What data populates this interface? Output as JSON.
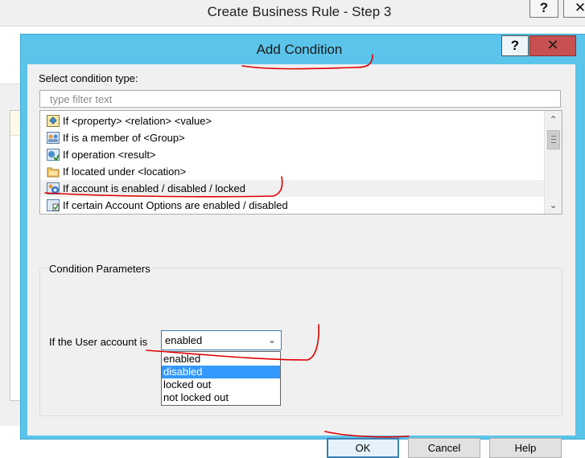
{
  "background_window": {
    "title": "Create Business Rule - Step 3",
    "help_label": "?",
    "close_label": "✕"
  },
  "dialog": {
    "title": "Add Condition",
    "help_label": "?",
    "close_label": "✕",
    "select_label": "Select condition type:",
    "filter_placeholder": "type filter text",
    "conditions": [
      {
        "label": "If <property> <relation> <value>",
        "icon": "property-condition-icon"
      },
      {
        "label": "If is a member of <Group>",
        "icon": "group-condition-icon"
      },
      {
        "label": "If operation <result>",
        "icon": "operation-condition-icon"
      },
      {
        "label": "If located under <location>",
        "icon": "folder-condition-icon"
      },
      {
        "label": "If account is enabled / disabled / locked",
        "icon": "account-condition-icon",
        "selected": true
      },
      {
        "label": "If certain Account Options are enabled / disabled",
        "icon": "options-condition-icon"
      }
    ],
    "params_group_label": "Condition Parameters",
    "param_label": "If the User account is",
    "combo_value": "enabled",
    "dropdown_options": [
      "enabled",
      "disabled",
      "locked out",
      "not locked out"
    ],
    "highlighted_option": "disabled",
    "buttons": {
      "ok": "OK",
      "cancel": "Cancel",
      "help": "Help"
    }
  },
  "colors": {
    "title_bar": "#5bc4ea",
    "close_button": "#c75050",
    "highlight": "#3399ff",
    "annotation": "#e00000"
  }
}
